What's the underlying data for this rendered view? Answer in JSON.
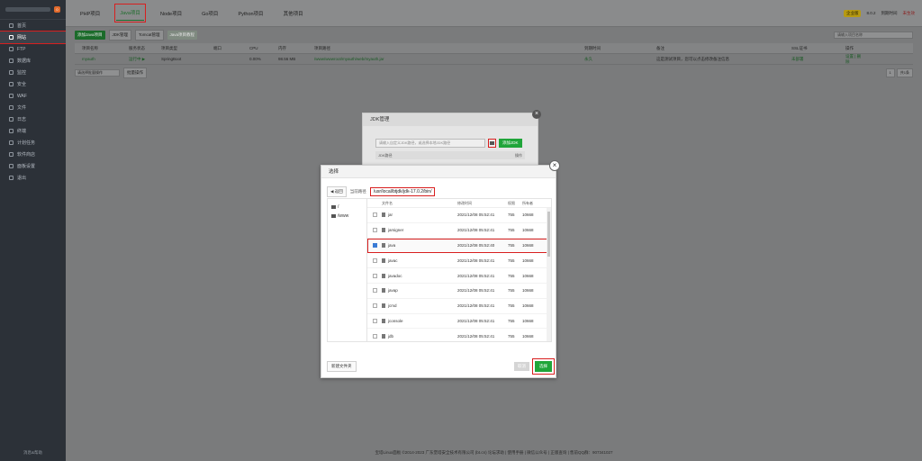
{
  "sidebar": {
    "badge": "0",
    "items": [
      {
        "label": "首页",
        "icon": "home-icon"
      },
      {
        "label": "网站",
        "icon": "globe-icon"
      },
      {
        "label": "FTP",
        "icon": "ftp-icon"
      },
      {
        "label": "数据库",
        "icon": "database-icon"
      },
      {
        "label": "监控",
        "icon": "monitor-icon"
      },
      {
        "label": "安全",
        "icon": "shield-icon"
      },
      {
        "label": "WAF",
        "icon": "waf-icon"
      },
      {
        "label": "文件",
        "icon": "folder-icon"
      },
      {
        "label": "日志",
        "icon": "log-icon"
      },
      {
        "label": "终端",
        "icon": "terminal-icon"
      },
      {
        "label": "计划任务",
        "icon": "clock-icon"
      },
      {
        "label": "软件商店",
        "icon": "store-icon"
      },
      {
        "label": "面板设置",
        "icon": "gear-icon"
      },
      {
        "label": "退出",
        "icon": "logout-icon"
      }
    ],
    "footer": "消息&帮助"
  },
  "topbar": {
    "tabs": [
      "PHP项目",
      "Java项目",
      "Node项目",
      "Go项目",
      "Python项目",
      "其他项目"
    ],
    "vip": "企业版",
    "version": "8.0.2",
    "upgrade": "到期时间",
    "renew": "未生效"
  },
  "toolbar": {
    "add": "添加Java项目",
    "jdk": "JDK管理",
    "tomcat": "Tomcat管理",
    "course": "Java项目教程",
    "search_placeholder": "请输入项目名称"
  },
  "table": {
    "headers": [
      "项目名称",
      "服务状态",
      "项目类型",
      "端口",
      "CPU",
      "内存",
      "项目路径",
      "到期时间",
      "备注",
      "SSL证书",
      "操作"
    ],
    "row": {
      "name": "myauth",
      "status": "运行中 ▶",
      "type": "SpringBoot",
      "cpu": "0.00%",
      "mem": "98.56 MB",
      "path": "/www/wwwroot/myauth/web/myauth.jar",
      "expire": "永久",
      "note": "这是测试项目，您可以点击修改备注信息",
      "ssl": "未部署",
      "actions": "设置 | 删除"
    },
    "batch": "请选择批量操作",
    "batch_btn": "批量操作",
    "page": "1",
    "total": "共1条"
  },
  "jdk_dialog": {
    "title": "JDK管理",
    "placeholder": "请输入自定义JDK路径，或选择本地JDK路径",
    "add": "添加JDK",
    "col_path": "JDK路径",
    "col_op": "操作"
  },
  "file_dialog": {
    "title": "选择",
    "back": "返回",
    "path_label": "当前路径",
    "path": "/usr/local/btjdk/jdk-17.0.2/bin/",
    "drives": [
      "/",
      "/www"
    ],
    "headers": [
      "文件名",
      "修改时间",
      "权限",
      "所有者"
    ],
    "files": [
      {
        "name": "jar",
        "time": "2021/12/08 05:52:41",
        "perm": "755",
        "owner": "10668",
        "checked": false
      },
      {
        "name": "jarsigner",
        "time": "2021/12/08 05:52:41",
        "perm": "755",
        "owner": "10668",
        "checked": false
      },
      {
        "name": "java",
        "time": "2021/12/08 05:52:40",
        "perm": "755",
        "owner": "10668",
        "checked": true
      },
      {
        "name": "javac",
        "time": "2021/12/08 05:52:41",
        "perm": "755",
        "owner": "10668",
        "checked": false
      },
      {
        "name": "javadoc",
        "time": "2021/12/08 05:52:41",
        "perm": "755",
        "owner": "10668",
        "checked": false
      },
      {
        "name": "javap",
        "time": "2021/12/08 05:52:41",
        "perm": "755",
        "owner": "10668",
        "checked": false
      },
      {
        "name": "jcmd",
        "time": "2021/12/08 05:52:41",
        "perm": "755",
        "owner": "10668",
        "checked": false
      },
      {
        "name": "jconsole",
        "time": "2021/12/08 05:52:41",
        "perm": "755",
        "owner": "10668",
        "checked": false
      },
      {
        "name": "jdb",
        "time": "2021/12/08 05:52:41",
        "perm": "755",
        "owner": "10668",
        "checked": false
      },
      {
        "name": "jdeprscan",
        "time": "2021/12/08 05:52:41",
        "perm": "755",
        "owner": "10668",
        "checked": false
      }
    ],
    "new_folder": "新建文件夹",
    "cancel": "取消",
    "select": "选择"
  },
  "footer": "宝塔Linux面板 ©2014-2023 广东堡塔安全技术有限公司 (bt.cn)  论坛求助 | 使用手册 | 微信公众号 | 正版查询 | 售前QQ群：907341027"
}
